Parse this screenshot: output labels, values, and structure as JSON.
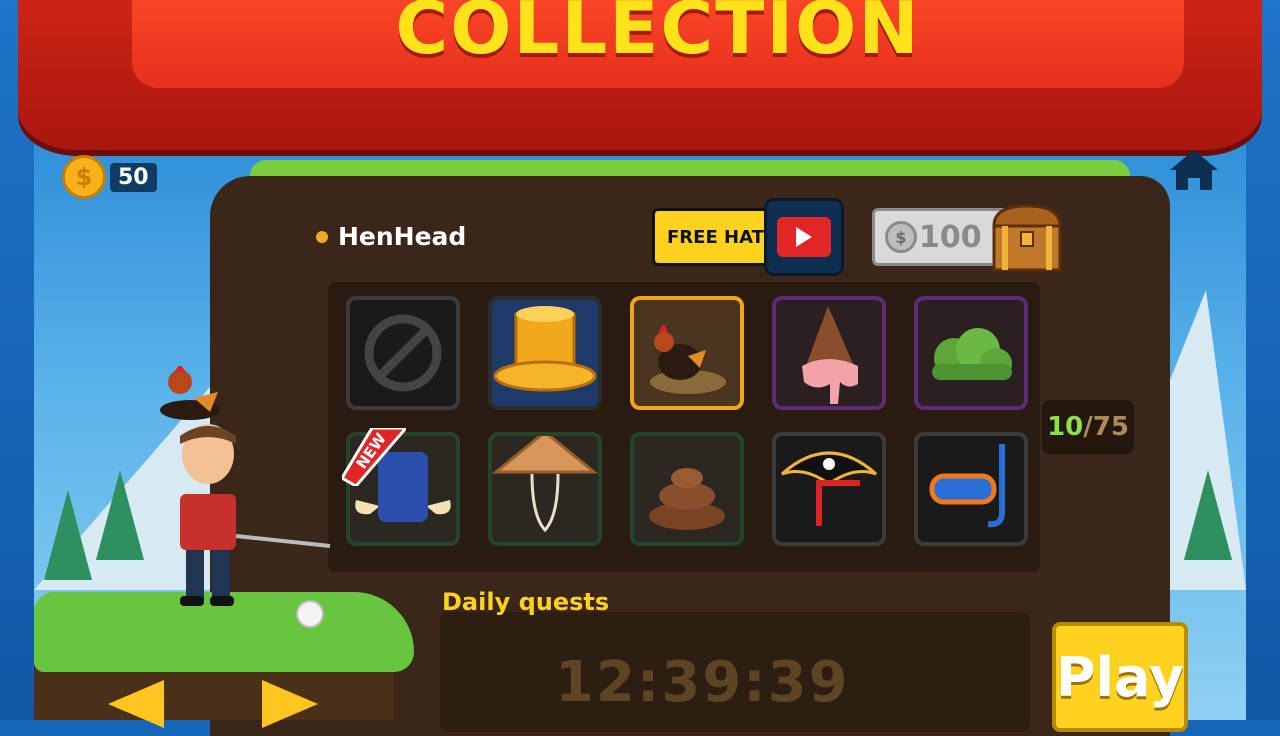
{
  "banner": {
    "title": "COLLECTION"
  },
  "wallet": {
    "coins": "50",
    "coin_symbol": "$"
  },
  "selected_hat": {
    "name": "HenHead"
  },
  "free_hat": {
    "label": "FREE HAT",
    "icon": "video-tv-icon"
  },
  "buy": {
    "coin_symbol": "$",
    "price": "100",
    "icon": "treasure-chest-icon"
  },
  "grid": {
    "cells": [
      {
        "name": "none",
        "icon": "no-hat-icon",
        "state": "available"
      },
      {
        "name": "gold-top-hat",
        "icon": "gold-top-hat-icon",
        "state": "available"
      },
      {
        "name": "henhead",
        "icon": "chicken-nest-hat-icon",
        "state": "selected"
      },
      {
        "name": "ice-cream-cone",
        "icon": "ice-cream-cone-hat-icon",
        "state": "available"
      },
      {
        "name": "bush",
        "icon": "bush-hat-icon",
        "state": "available"
      },
      {
        "name": "viking-helmet",
        "icon": "viking-helmet-icon",
        "state": "new",
        "badge": "NEW"
      },
      {
        "name": "straw-hat",
        "icon": "conical-straw-hat-icon",
        "state": "available"
      },
      {
        "name": "poop",
        "icon": "poop-hat-icon",
        "state": "available"
      },
      {
        "name": "pirate-hat",
        "icon": "pirate-hat-icon",
        "state": "available"
      },
      {
        "name": "snorkel-mask",
        "icon": "snorkel-mask-icon",
        "state": "available"
      }
    ]
  },
  "collection_count": {
    "current": "10",
    "separator": "/",
    "total": "75"
  },
  "daily_quests": {
    "title": "Daily quests",
    "timer": "12:39:39"
  },
  "play": {
    "label": "Play"
  },
  "colors": {
    "banner_red": "#e5311c",
    "title_yellow": "#ffe21a",
    "button_yellow": "#ffd21f",
    "selected_border": "#f3a51a",
    "count_green": "#8ee04a"
  }
}
